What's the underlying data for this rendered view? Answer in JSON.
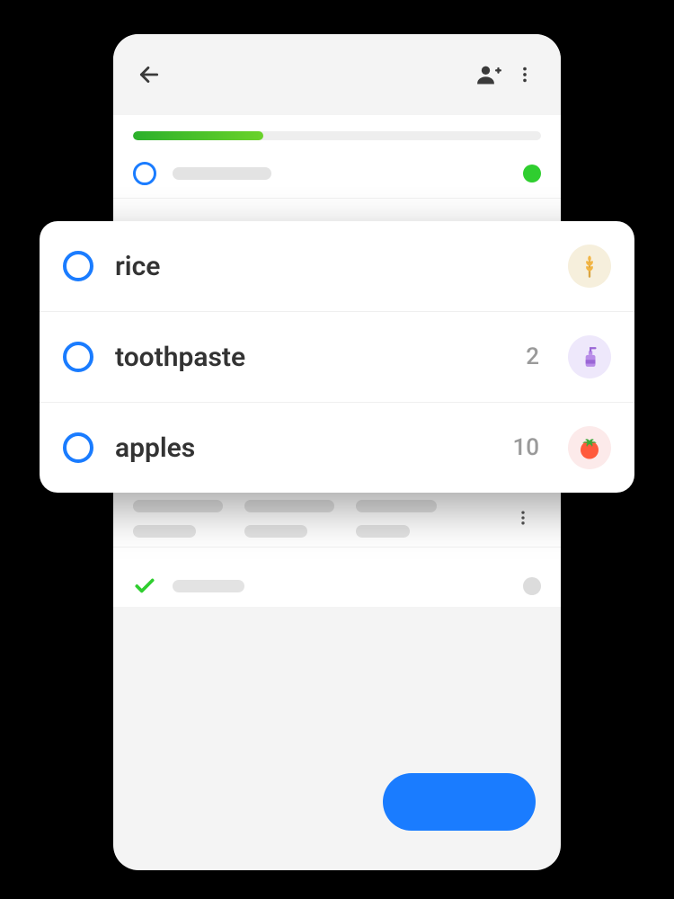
{
  "progress": {
    "percent": 32
  },
  "card_items": [
    {
      "label": "rice",
      "qty": "",
      "category": "grain"
    },
    {
      "label": "toothpaste",
      "qty": "2",
      "category": "hygiene"
    },
    {
      "label": "apples",
      "qty": "10",
      "category": "produce"
    }
  ]
}
